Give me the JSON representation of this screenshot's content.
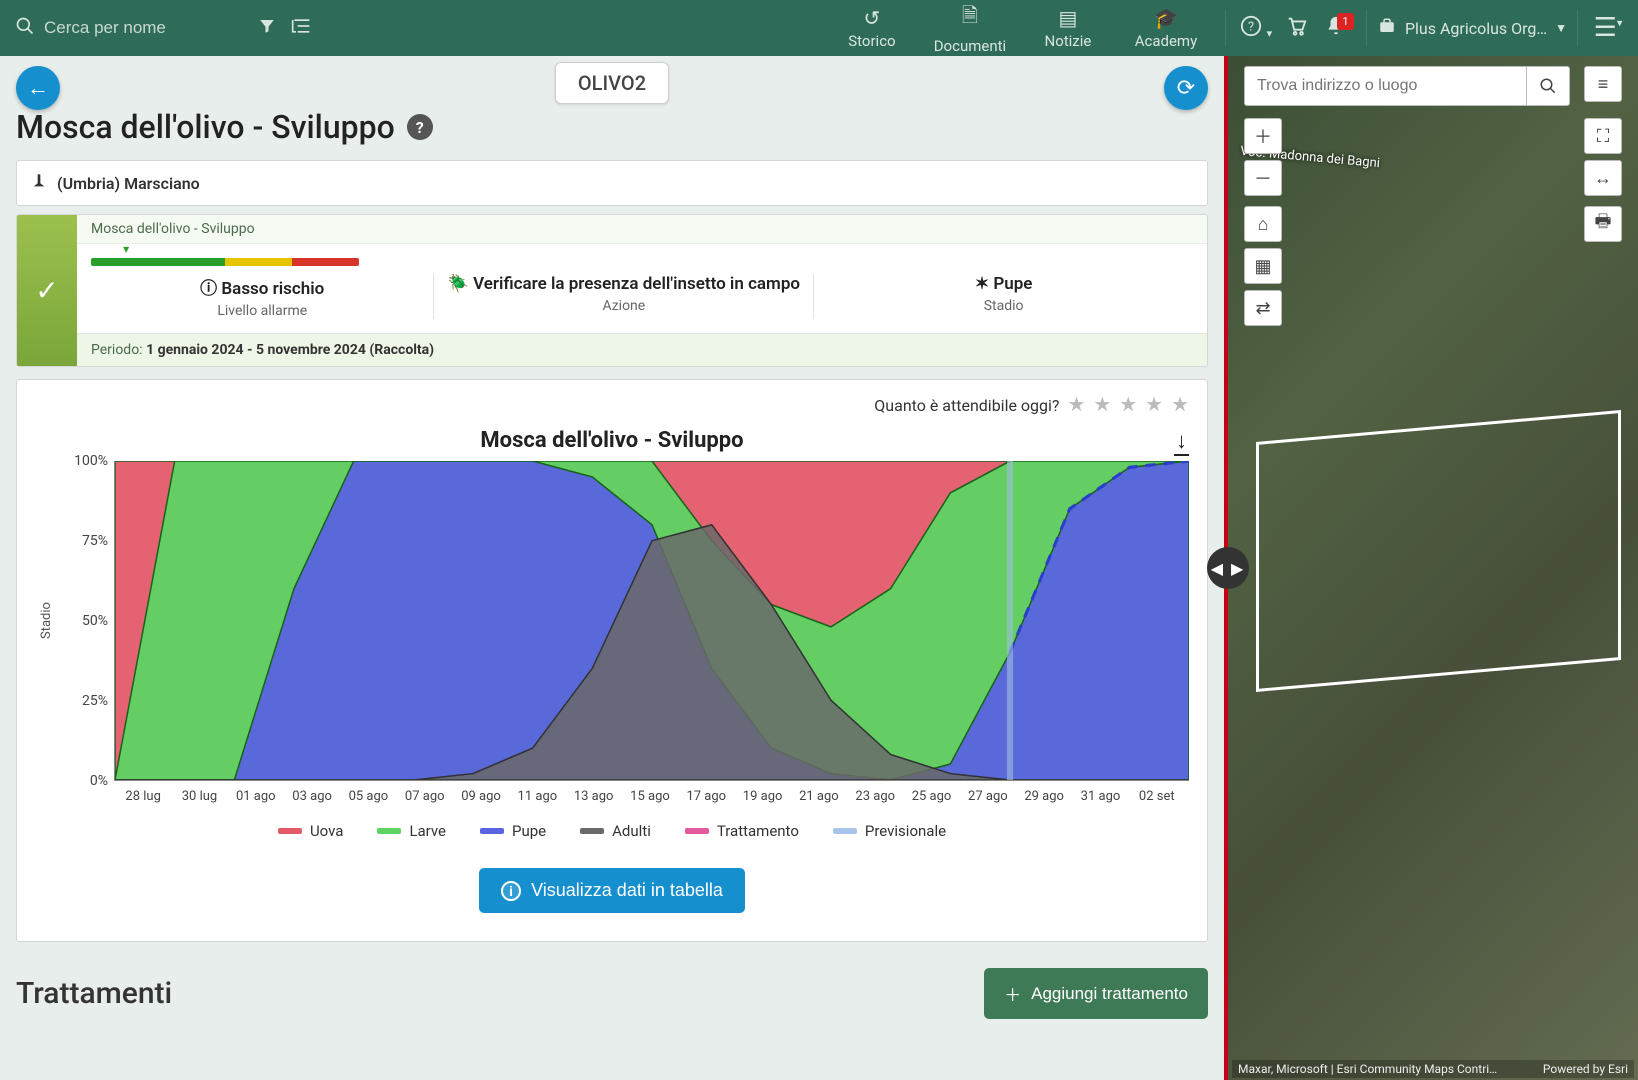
{
  "topbar": {
    "search_placeholder": "Cerca per nome",
    "nav": {
      "storico": "Storico",
      "documenti": "Documenti",
      "notizie": "Notizie",
      "academy": "Academy"
    },
    "notif_count": "1",
    "org_label": "Plus Agricolus Org…"
  },
  "chip": {
    "label": "OLIVO2"
  },
  "page": {
    "title": "Mosca dell'olivo - Sviluppo"
  },
  "location": {
    "text": "(Umbria) Marsciano"
  },
  "status": {
    "header": "Mosca dell'olivo - Sviluppo",
    "risk_label": "Basso rischio",
    "risk_sub": "Livello allarme",
    "action_label": "Verificare la presenza dell'insetto in campo",
    "action_sub": "Azione",
    "stage_label": "Pupe",
    "stage_sub": "Stadio",
    "period_prefix": "Periodo:",
    "period_value": "1 gennaio 2024 - 5 novembre 2024 (Raccolta)"
  },
  "reliability": {
    "question": "Quanto è attendibile oggi?"
  },
  "chart": {
    "title": "Mosca dell'olivo - Sviluppo",
    "button_view_table": "Visualizza dati in tabella"
  },
  "chart_data": {
    "type": "area",
    "ylabel": "Stadio",
    "ylim": [
      0,
      100
    ],
    "yticks": [
      "0%",
      "25%",
      "50%",
      "75%",
      "100%"
    ],
    "categories": [
      "28 lug",
      "30 lug",
      "01 ago",
      "03 ago",
      "05 ago",
      "07 ago",
      "09 ago",
      "11 ago",
      "13 ago",
      "15 ago",
      "17 ago",
      "19 ago",
      "21 ago",
      "23 ago",
      "25 ago",
      "27 ago",
      "29 ago",
      "31 ago",
      "02 set"
    ],
    "series": [
      {
        "name": "Uova",
        "color": "#e35a6a",
        "values": [
          100,
          100,
          100,
          100,
          100,
          100,
          100,
          100,
          100,
          100,
          100,
          100,
          100,
          100,
          100,
          100,
          100,
          100,
          100
        ]
      },
      {
        "name": "Larve",
        "color": "#5dd463",
        "values": [
          0,
          100,
          100,
          100,
          100,
          100,
          100,
          100,
          100,
          100,
          75,
          55,
          48,
          60,
          90,
          100,
          100,
          100,
          100
        ]
      },
      {
        "name": "Pupe",
        "color": "#5a63e0",
        "values": [
          0,
          0,
          0,
          60,
          100,
          100,
          100,
          100,
          95,
          80,
          35,
          10,
          2,
          0,
          5,
          40,
          85,
          98,
          100
        ],
        "forecast_from_index": 15
      },
      {
        "name": "Adulti",
        "color": "#6a6a6a",
        "values": [
          0,
          0,
          0,
          0,
          0,
          0,
          2,
          10,
          35,
          75,
          80,
          55,
          25,
          8,
          2,
          0,
          0,
          0,
          0
        ]
      }
    ],
    "extra_legend": [
      {
        "name": "Trattamento",
        "color": "#e35a9d"
      },
      {
        "name": "Previsionale",
        "color": "#a9c4ea"
      }
    ],
    "forecast_band": {
      "from_index": 15,
      "to_index": 19,
      "color": "#cfe7d3"
    }
  },
  "treatments": {
    "title": "Trattamenti",
    "add_button": "Aggiungi trattamento"
  },
  "map": {
    "search_placeholder": "Trova indirizzo o luogo",
    "road_label": "Voc. Madonna dei Bagni",
    "attr_left": "Maxar, Microsoft | Esri Community Maps Contri…",
    "attr_right": "Powered by Esri"
  }
}
